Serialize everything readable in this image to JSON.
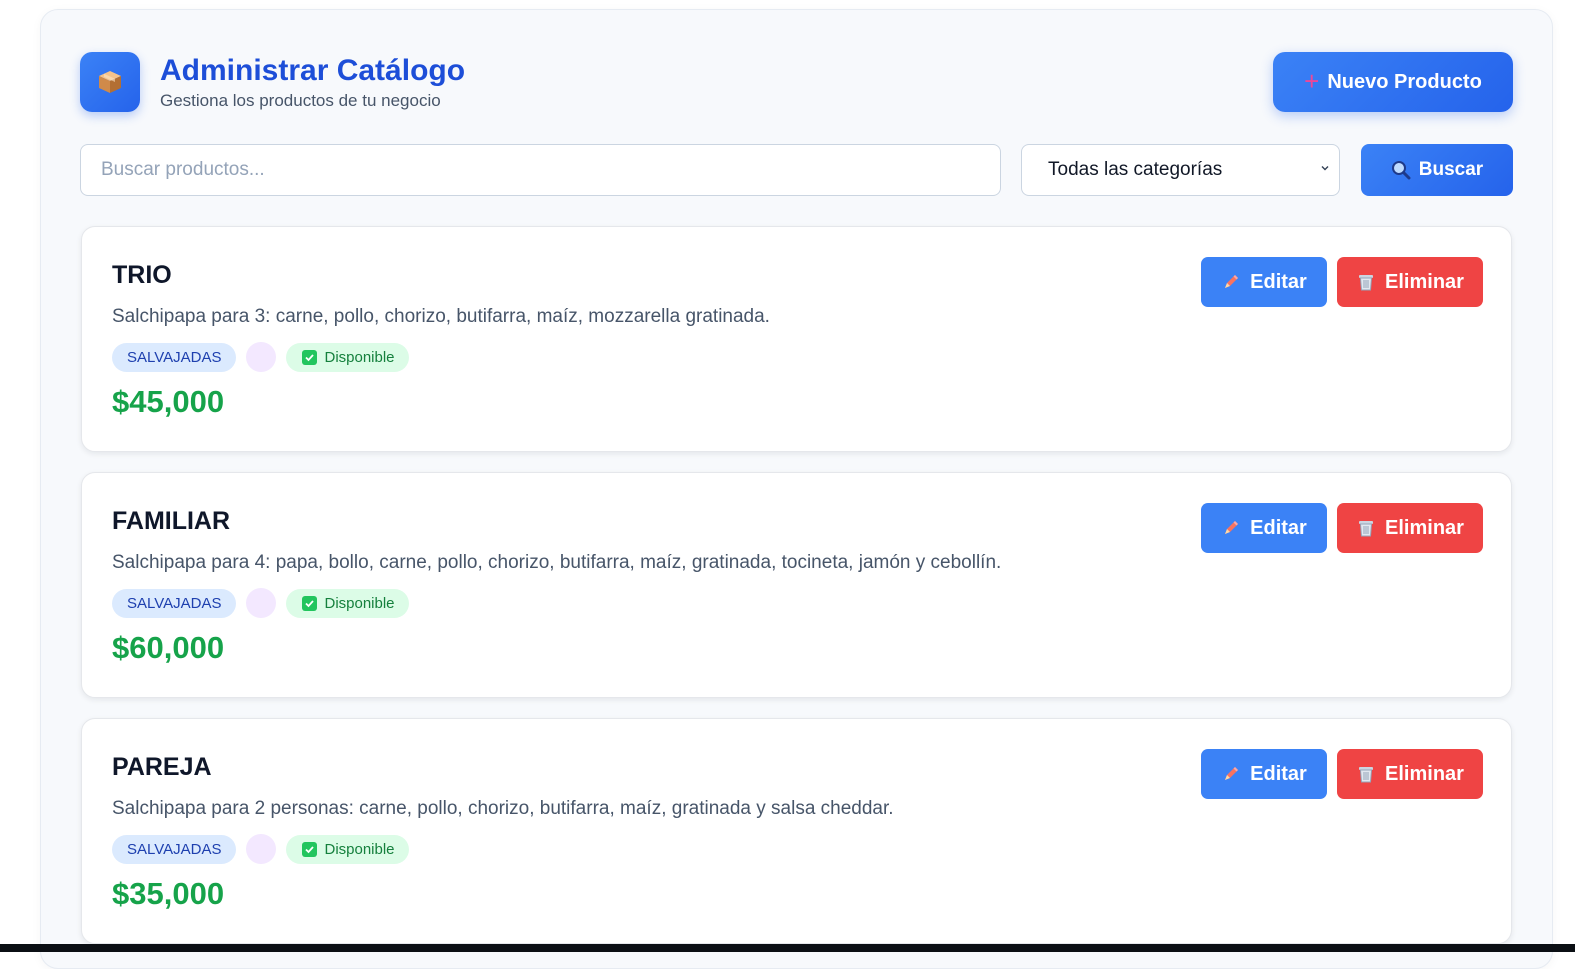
{
  "header": {
    "logo_icon": "package-box-icon",
    "title": "Administrar Catálogo",
    "subtitle": "Gestiona los productos de tu negocio",
    "new_button": "Nuevo Producto",
    "new_button_icon": "plus-icon"
  },
  "search": {
    "placeholder": "Buscar productos...",
    "value": "",
    "category_selected": "Todas las categorías",
    "button": "Buscar",
    "button_icon": "magnifier-icon"
  },
  "actions": {
    "edit": "Editar",
    "delete": "Eliminar",
    "edit_icon": "pencil-icon",
    "delete_icon": "trash-icon"
  },
  "products": [
    {
      "name": "TRIO",
      "description": "Salchipapa para 3: carne, pollo, chorizo, butifarra, maíz, mozzarella gratinada.",
      "category": "SALVAJADAS",
      "status": "Disponible",
      "price": "$45,000"
    },
    {
      "name": "FAMILIAR",
      "description": "Salchipapa para 4: papa, bollo, carne, pollo, chorizo, butifarra, maíz, gratinada, tocineta, jamón y cebollín.",
      "category": "SALVAJADAS",
      "status": "Disponible",
      "price": "$60,000"
    },
    {
      "name": "PAREJA",
      "description": "Salchipapa para 2 personas: carne, pollo, chorizo, butifarra, maíz, gratinada y salsa cheddar.",
      "category": "SALVAJADAS",
      "status": "Disponible",
      "price": "$35,000"
    }
  ],
  "colors": {
    "accent": "#2563eb",
    "title": "#1d4ed8",
    "danger": "#ef4444",
    "price": "#16a34a",
    "available_bg": "#dcfce7",
    "category_bg": "#dbeafe"
  }
}
